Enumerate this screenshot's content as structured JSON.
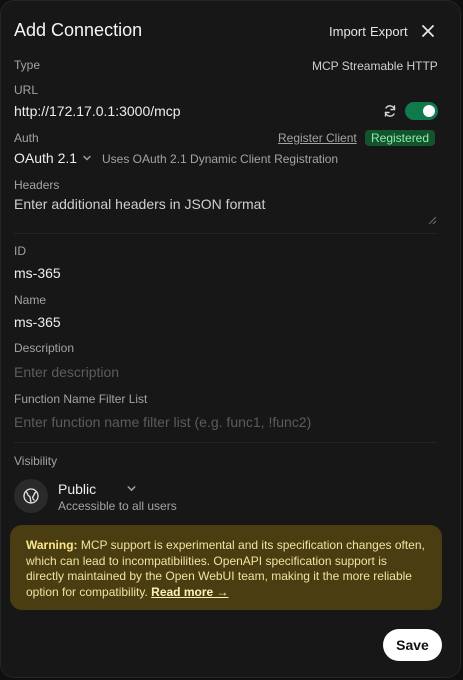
{
  "header": {
    "title": "Add Connection",
    "import_label": "Import",
    "export_label": "Export"
  },
  "type": {
    "label": "Type",
    "value": "MCP Streamable HTTP"
  },
  "url": {
    "label": "URL",
    "value": "http://172.17.0.1:3000/mcp",
    "enabled": true
  },
  "auth": {
    "label": "Auth",
    "register_label": "Register Client",
    "status_badge": "Registered",
    "method": "OAuth 2.1",
    "hint": "Uses OAuth 2.1 Dynamic Client Registration"
  },
  "headers": {
    "label": "Headers",
    "placeholder": "Enter additional headers in JSON format"
  },
  "id_field": {
    "label": "ID",
    "value": "ms-365"
  },
  "name_field": {
    "label": "Name",
    "value": "ms-365"
  },
  "description": {
    "label": "Description",
    "placeholder": "Enter description"
  },
  "filter": {
    "label": "Function Name Filter List",
    "placeholder": "Enter function name filter list (e.g. func1, !func2)"
  },
  "visibility": {
    "label": "Visibility",
    "value": "Public",
    "hint": "Accessible to all users"
  },
  "warning": {
    "prefix": "Warning:",
    "text": " MCP support is experimental and its specification changes often, which can lead to incompatibilities. OpenAPI specification support is directly maintained by the Open WebUI team, making it the more reliable option for compatibility. ",
    "link": "Read more →"
  },
  "actions": {
    "save_label": "Save"
  },
  "colors": {
    "toggle_on": "#0f7b4d",
    "badge_bg": "#14532d",
    "badge_text": "#86efac",
    "warning_bg": "#4a3d12"
  }
}
